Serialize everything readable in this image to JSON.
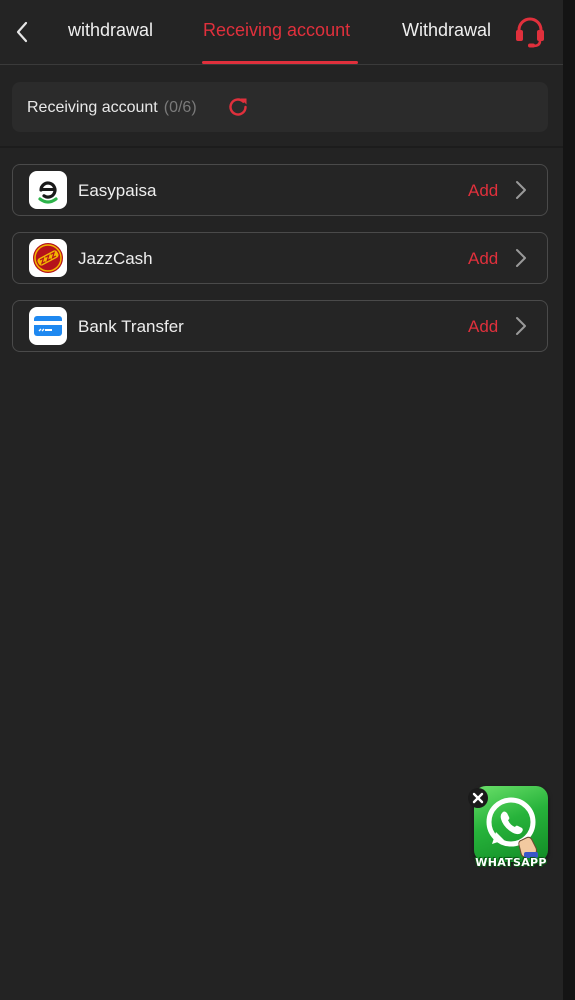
{
  "header": {
    "tabs": [
      {
        "label": "withdrawal",
        "active": false
      },
      {
        "label": "Receiving account",
        "active": true
      },
      {
        "label": "Withdrawal",
        "active": false
      }
    ],
    "icons": {
      "back": "chevron-left-icon",
      "support": "headset-icon"
    }
  },
  "summary": {
    "label": "Receiving account",
    "count": "(0/6)",
    "refresh_icon": "refresh-icon"
  },
  "methods": [
    {
      "name": "Easypaisa",
      "action": "Add",
      "logo": "easypaisa-logo"
    },
    {
      "name": "JazzCash",
      "action": "Add",
      "logo": "jazzcash-logo"
    },
    {
      "name": "Bank Transfer",
      "action": "Add",
      "logo": "bank-card-icon"
    }
  ],
  "whatsapp": {
    "label": "WHATSAPP",
    "close_icon": "close-icon"
  },
  "colors": {
    "accent": "#e0303c",
    "background": "#232323",
    "card_border": "#4a4a4a",
    "whatsapp_green": "#27b33b"
  }
}
